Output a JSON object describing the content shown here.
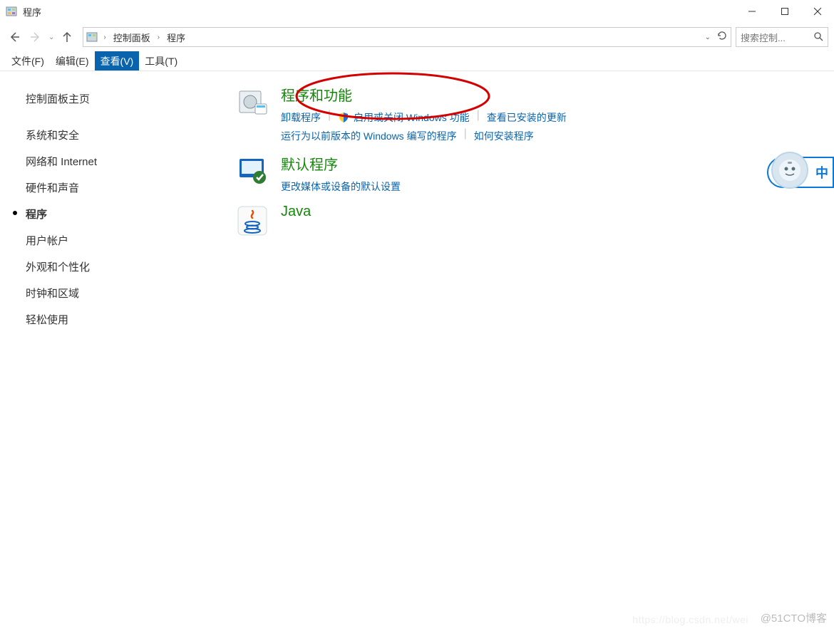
{
  "window": {
    "title": "程序"
  },
  "breadcrumb": {
    "root": "控制面板",
    "current": "程序"
  },
  "search": {
    "placeholder": "搜索控制..."
  },
  "menu": {
    "file": "文件(F)",
    "edit": "编辑(E)",
    "view": "查看(V)",
    "tools": "工具(T)"
  },
  "sidebar": {
    "home": "控制面板主页",
    "items": [
      "系统和安全",
      "网络和 Internet",
      "硬件和声音",
      "程序",
      "用户帐户",
      "外观和个性化",
      "时钟和区域",
      "轻松使用"
    ],
    "current_index": 3
  },
  "sections": {
    "programs_features": {
      "title": "程序和功能",
      "links": {
        "uninstall": "卸载程序",
        "win_features": "启用或关闭 Windows 功能",
        "view_updates": "查看已安装的更新",
        "compat": "运行为以前版本的 Windows 编写的程序",
        "howto_install": "如何安装程序"
      }
    },
    "default_programs": {
      "title": "默认程序",
      "links": {
        "media": "更改媒体或设备的默认设置"
      }
    },
    "java": {
      "title": "Java"
    }
  },
  "float_widget": {
    "label": "中"
  },
  "watermark": "@51CTO博客",
  "watermark2": "https://blog.csdn.net/wei"
}
